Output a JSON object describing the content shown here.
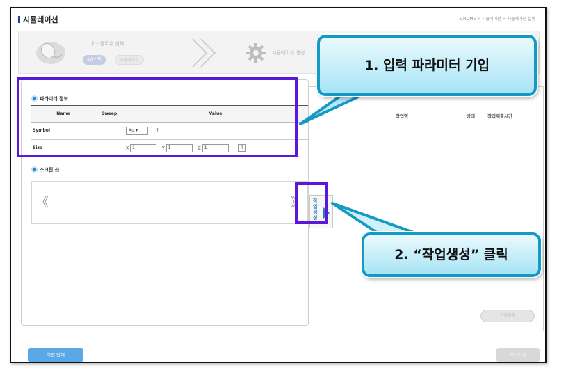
{
  "header": {
    "title": "시뮬레이션",
    "breadcrumb": "⌂ HOME > 시뮬레이션 > 시뮬레이션 실행"
  },
  "wizard": {
    "step1_title": "워크플로우 선택",
    "step1_btn_active": "SW선택",
    "step1_btn_inactive": "시뮬레이션",
    "step2_title": "시뮬레이션 생성"
  },
  "params": {
    "section_title": "파라미터 정보",
    "columns": [
      "Name",
      "Sweep",
      "Value"
    ],
    "symbol_label": "Symbol",
    "symbol_value": "Au",
    "help_label": "?",
    "size_label": "Size",
    "size_x_label": "X",
    "size_x_value": "1",
    "size_y_label": "Y",
    "size_y_value": "1",
    "size_z_label": "Z",
    "size_z_value": "1"
  },
  "screenshot": {
    "section_title": "스크린 샷",
    "prev_arrow": "《",
    "next_arrow": "》"
  },
  "create_job": {
    "label": "작업생성"
  },
  "jobs": {
    "col_job_name": "작업명",
    "col_status": "상태",
    "col_submit_time": "작업제출시간",
    "submit_label": "작업제출"
  },
  "footer": {
    "prev_step": "이전 단계",
    "monitoring": "모니터링"
  },
  "callouts": {
    "step1": "1. 입력 파라미터 기입",
    "step2": "2. “작업생성” 클릭"
  },
  "colors": {
    "highlight": "#5a18d8",
    "callout_border": "#159ac4",
    "accent_blue": "#2a87c8"
  }
}
